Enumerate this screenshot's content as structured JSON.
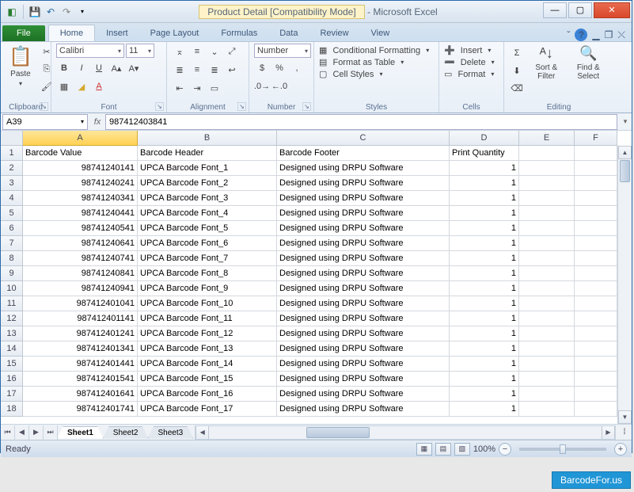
{
  "window": {
    "title_doc": "Product Detail  [Compatibility Mode]",
    "title_app": " - Microsoft Excel"
  },
  "tabs": {
    "file": "File",
    "list": [
      "Home",
      "Insert",
      "Page Layout",
      "Formulas",
      "Data",
      "Review",
      "View"
    ],
    "active": 0
  },
  "ribbon": {
    "clipboard": {
      "paste": "Paste",
      "label": "Clipboard"
    },
    "font": {
      "name": "Calibri",
      "size": "11",
      "label": "Font"
    },
    "alignment": {
      "label": "Alignment"
    },
    "number": {
      "format": "Number",
      "label": "Number"
    },
    "styles": {
      "cond": "Conditional Formatting",
      "table": "Format as Table",
      "cell": "Cell Styles",
      "label": "Styles"
    },
    "cells": {
      "insert": "Insert",
      "delete": "Delete",
      "format": "Format",
      "label": "Cells"
    },
    "editing": {
      "sort": "Sort & Filter",
      "find": "Find & Select",
      "label": "Editing"
    }
  },
  "namebox": "A39",
  "formula": "987412403841",
  "columns": [
    "A",
    "B",
    "C",
    "D",
    "E",
    "F"
  ],
  "headers": {
    "A": "Barcode Value",
    "B": "Barcode Header",
    "C": "Barcode Footer",
    "D": "Print Quantity"
  },
  "rows": [
    {
      "n": 1,
      "A": "Barcode Value",
      "B": "Barcode Header",
      "C": "Barcode Footer",
      "D": "Print Quantity",
      "hdr": true
    },
    {
      "n": 2,
      "A": "98741240141",
      "B": "UPCA Barcode Font_1",
      "C": "Designed using DRPU Software",
      "D": "1"
    },
    {
      "n": 3,
      "A": "98741240241",
      "B": "UPCA Barcode Font_2",
      "C": "Designed using DRPU Software",
      "D": "1"
    },
    {
      "n": 4,
      "A": "98741240341",
      "B": "UPCA Barcode Font_3",
      "C": "Designed using DRPU Software",
      "D": "1"
    },
    {
      "n": 5,
      "A": "98741240441",
      "B": "UPCA Barcode Font_4",
      "C": "Designed using DRPU Software",
      "D": "1"
    },
    {
      "n": 6,
      "A": "98741240541",
      "B": "UPCA Barcode Font_5",
      "C": "Designed using DRPU Software",
      "D": "1"
    },
    {
      "n": 7,
      "A": "98741240641",
      "B": "UPCA Barcode Font_6",
      "C": "Designed using DRPU Software",
      "D": "1"
    },
    {
      "n": 8,
      "A": "98741240741",
      "B": "UPCA Barcode Font_7",
      "C": "Designed using DRPU Software",
      "D": "1"
    },
    {
      "n": 9,
      "A": "98741240841",
      "B": "UPCA Barcode Font_8",
      "C": "Designed using DRPU Software",
      "D": "1"
    },
    {
      "n": 10,
      "A": "98741240941",
      "B": "UPCA Barcode Font_9",
      "C": "Designed using DRPU Software",
      "D": "1"
    },
    {
      "n": 11,
      "A": "987412401041",
      "B": "UPCA Barcode Font_10",
      "C": "Designed using DRPU Software",
      "D": "1"
    },
    {
      "n": 12,
      "A": "987412401141",
      "B": "UPCA Barcode Font_11",
      "C": "Designed using DRPU Software",
      "D": "1"
    },
    {
      "n": 13,
      "A": "987412401241",
      "B": "UPCA Barcode Font_12",
      "C": "Designed using DRPU Software",
      "D": "1"
    },
    {
      "n": 14,
      "A": "987412401341",
      "B": "UPCA Barcode Font_13",
      "C": "Designed using DRPU Software",
      "D": "1"
    },
    {
      "n": 15,
      "A": "987412401441",
      "B": "UPCA Barcode Font_14",
      "C": "Designed using DRPU Software",
      "D": "1"
    },
    {
      "n": 16,
      "A": "987412401541",
      "B": "UPCA Barcode Font_15",
      "C": "Designed using DRPU Software",
      "D": "1"
    },
    {
      "n": 17,
      "A": "987412401641",
      "B": "UPCA Barcode Font_16",
      "C": "Designed using DRPU Software",
      "D": "1"
    },
    {
      "n": 18,
      "A": "987412401741",
      "B": "UPCA Barcode Font_17",
      "C": "Designed using DRPU Software",
      "D": "1"
    }
  ],
  "sheets": [
    "Sheet1",
    "Sheet2",
    "Sheet3"
  ],
  "status": {
    "ready": "Ready",
    "zoom": "100%"
  },
  "watermark": "BarcodeFor.us"
}
